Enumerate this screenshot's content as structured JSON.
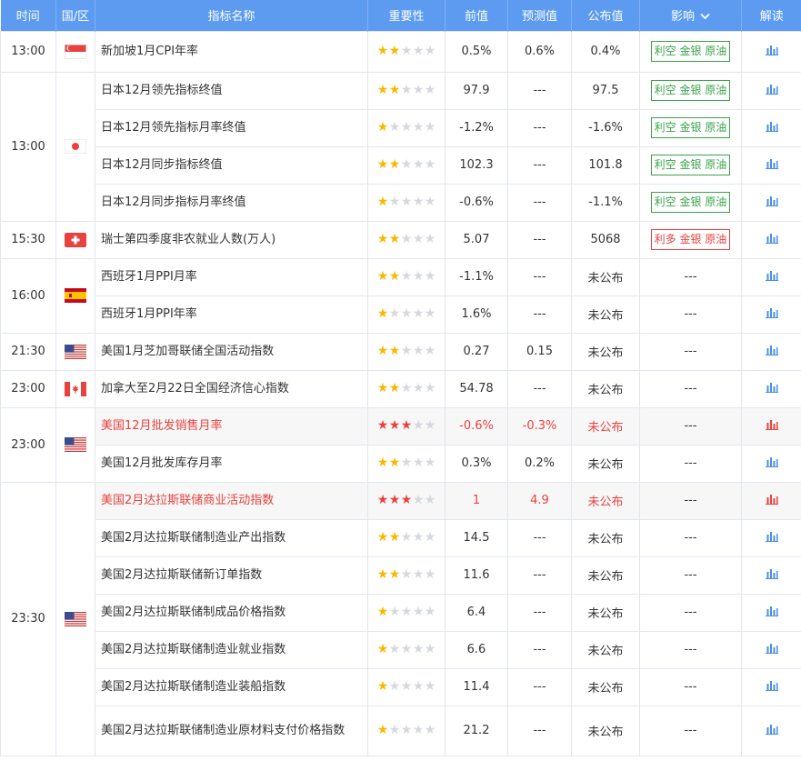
{
  "header": {
    "time": "时间",
    "country": "国/区",
    "indicator": "指标名称",
    "importance": "重要性",
    "previous": "前值",
    "forecast": "预测值",
    "actual": "公布值",
    "impact": "影响",
    "interpret": "解读"
  },
  "colors": {
    "header_bg": "#5c9bf0",
    "bearish": "#3aa34a",
    "bullish": "#e8423f",
    "star": "#f7b900"
  },
  "groups": [
    {
      "time": "13:00",
      "country": "singapore-flag",
      "rows": [
        {
          "name": "新加坡1月CPI年率",
          "stars": 2,
          "prev": "0.5%",
          "fcst": "0.6%",
          "act": "0.4%",
          "impact": "利空 金银 原油",
          "impact_type": "bear",
          "hl": false
        }
      ]
    },
    {
      "time": "13:00",
      "country": "japan-flag",
      "rows": [
        {
          "name": "日本12月领先指标终值",
          "stars": 2,
          "prev": "97.9",
          "fcst": "---",
          "act": "97.5",
          "impact": "利空 金银 原油",
          "impact_type": "bear",
          "hl": false
        },
        {
          "name": "日本12月领先指标月率终值",
          "stars": 1,
          "prev": "-1.2%",
          "fcst": "---",
          "act": "-1.6%",
          "impact": "利空 金银 原油",
          "impact_type": "bear",
          "hl": false
        },
        {
          "name": "日本12月同步指标终值",
          "stars": 2,
          "prev": "102.3",
          "fcst": "---",
          "act": "101.8",
          "impact": "利空 金银 原油",
          "impact_type": "bear",
          "hl": false
        },
        {
          "name": "日本12月同步指标月率终值",
          "stars": 1,
          "prev": "-0.6%",
          "fcst": "---",
          "act": "-1.1%",
          "impact": "利空 金银 原油",
          "impact_type": "bear",
          "hl": false
        }
      ]
    },
    {
      "time": "15:30",
      "country": "switzerland-flag",
      "rows": [
        {
          "name": "瑞士第四季度非农就业人数(万人)",
          "stars": 2,
          "prev": "5.07",
          "fcst": "---",
          "act": "5068",
          "impact": "利多 金银 原油",
          "impact_type": "bull",
          "hl": false
        }
      ]
    },
    {
      "time": "16:00",
      "country": "spain-flag",
      "rows": [
        {
          "name": "西班牙1月PPI月率",
          "stars": 2,
          "prev": "-1.1%",
          "fcst": "---",
          "act": "未公布",
          "impact": "---",
          "impact_type": "none",
          "hl": false
        },
        {
          "name": "西班牙1月PPI年率",
          "stars": 1,
          "prev": "1.6%",
          "fcst": "---",
          "act": "未公布",
          "impact": "---",
          "impact_type": "none",
          "hl": false
        }
      ]
    },
    {
      "time": "21:30",
      "country": "usa-flag",
      "rows": [
        {
          "name": "美国1月芝加哥联储全国活动指数",
          "stars": 2,
          "prev": "0.27",
          "fcst": "0.15",
          "act": "未公布",
          "impact": "---",
          "impact_type": "none",
          "hl": false
        }
      ]
    },
    {
      "time": "23:00",
      "country": "canada-flag",
      "rows": [
        {
          "name": "加拿大至2月22日全国经济信心指数",
          "stars": 2,
          "prev": "54.78",
          "fcst": "---",
          "act": "未公布",
          "impact": "---",
          "impact_type": "none",
          "hl": false
        }
      ]
    },
    {
      "time": "23:00",
      "country": "usa-flag",
      "rows": [
        {
          "name": "美国12月批发销售月率",
          "stars": 3,
          "prev": "-0.6%",
          "fcst": "-0.3%",
          "act": "未公布",
          "impact": "---",
          "impact_type": "none",
          "hl": true
        },
        {
          "name": "美国12月批发库存月率",
          "stars": 2,
          "prev": "0.3%",
          "fcst": "0.2%",
          "act": "未公布",
          "impact": "---",
          "impact_type": "none",
          "hl": false
        }
      ]
    },
    {
      "time": "23:30",
      "country": "usa-flag",
      "rows": [
        {
          "name": "美国2月达拉斯联储商业活动指数",
          "stars": 3,
          "prev": "1",
          "fcst": "4.9",
          "act": "未公布",
          "impact": "---",
          "impact_type": "none",
          "hl": true
        },
        {
          "name": "美国2月达拉斯联储制造业产出指数",
          "stars": 2,
          "prev": "14.5",
          "fcst": "---",
          "act": "未公布",
          "impact": "---",
          "impact_type": "none",
          "hl": false
        },
        {
          "name": "美国2月达拉斯联储新订单指数",
          "stars": 2,
          "prev": "11.6",
          "fcst": "---",
          "act": "未公布",
          "impact": "---",
          "impact_type": "none",
          "hl": false
        },
        {
          "name": "美国2月达拉斯联储制成品价格指数",
          "stars": 1,
          "prev": "6.4",
          "fcst": "---",
          "act": "未公布",
          "impact": "---",
          "impact_type": "none",
          "hl": false
        },
        {
          "name": "美国2月达拉斯联储制造业就业指数",
          "stars": 1,
          "prev": "6.6",
          "fcst": "---",
          "act": "未公布",
          "impact": "---",
          "impact_type": "none",
          "hl": false
        },
        {
          "name": "美国2月达拉斯联储制造业装船指数",
          "stars": 1,
          "prev": "11.4",
          "fcst": "---",
          "act": "未公布",
          "impact": "---",
          "impact_type": "none",
          "hl": false
        },
        {
          "name": "美国2月达拉斯联储制造业原材料支付价格指数",
          "stars": 1,
          "prev": "21.2",
          "fcst": "---",
          "act": "未公布",
          "impact": "---",
          "impact_type": "none",
          "hl": false
        }
      ]
    }
  ]
}
